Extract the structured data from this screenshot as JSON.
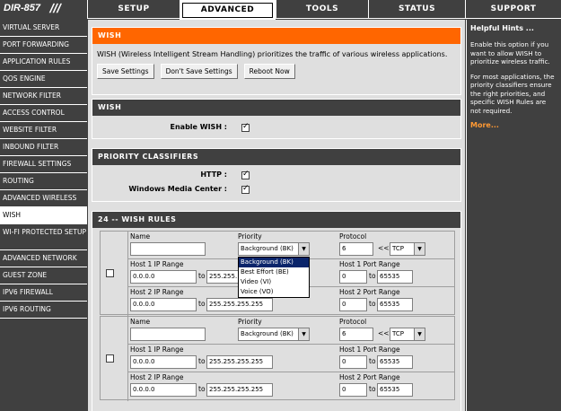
{
  "brand": {
    "logo": "DIR-857",
    "slashes": "///"
  },
  "top_tabs": [
    {
      "label": "SETUP"
    },
    {
      "label": "ADVANCED"
    },
    {
      "label": "TOOLS"
    },
    {
      "label": "STATUS"
    },
    {
      "label": "SUPPORT"
    }
  ],
  "sidebar": {
    "items": [
      {
        "label": "VIRTUAL SERVER"
      },
      {
        "label": "PORT FORWARDING"
      },
      {
        "label": "APPLICATION RULES"
      },
      {
        "label": "QOS ENGINE"
      },
      {
        "label": "NETWORK FILTER"
      },
      {
        "label": "ACCESS CONTROL"
      },
      {
        "label": "WEBSITE FILTER"
      },
      {
        "label": "INBOUND FILTER"
      },
      {
        "label": "FIREWALL SETTINGS"
      },
      {
        "label": "ROUTING"
      },
      {
        "label": "ADVANCED WIRELESS"
      },
      {
        "label": "WISH"
      },
      {
        "label": "WI-FI PROTECTED SETUP"
      },
      {
        "label": "ADVANCED NETWORK"
      },
      {
        "label": "GUEST ZONE"
      },
      {
        "label": "IPV6 FIREWALL"
      },
      {
        "label": "IPV6 ROUTING"
      }
    ],
    "active": "WISH"
  },
  "wish_intro": {
    "title": "WISH",
    "description": "WISH (Wireless Intelligent Stream Handling) prioritizes the traffic of various wireless applications.",
    "save_label": "Save Settings",
    "dont_save_label": "Don't Save Settings",
    "reboot_label": "Reboot Now"
  },
  "wish_section": {
    "title": "WISH",
    "enable_label": "Enable WISH :",
    "enable_checked": true
  },
  "priority_classifiers": {
    "title": "PRIORITY CLASSIFIERS",
    "http_label": "HTTP :",
    "http_checked": true,
    "wmc_label": "Windows Media Center :",
    "wmc_checked": true
  },
  "wish_rules": {
    "title": "24 -- WISH RULES",
    "labels": {
      "name": "Name",
      "priority": "Priority",
      "protocol": "Protocol",
      "host1_ip": "Host 1 IP Range",
      "host1_port": "Host 1 Port Range",
      "host2_ip": "Host 2 IP Range",
      "host2_port": "Host 2 Port Range",
      "to": "to",
      "arrows": "<<"
    },
    "rules": [
      {
        "name": "",
        "priority": "Background (BK)",
        "protocol_num": "6",
        "protocol": "TCP",
        "host1_ip_from": "0.0.0.0",
        "host1_ip_to": "255.255.",
        "host1_port_from": "0",
        "host1_port_to": "65535",
        "host2_ip_from": "0.0.0.0",
        "host2_ip_to": "255.255.255.255",
        "host2_port_from": "0",
        "host2_port_to": "65535"
      },
      {
        "name": "",
        "priority": "Background (BK)",
        "protocol_num": "6",
        "protocol": "TCP",
        "host1_ip_from": "0.0.0.0",
        "host1_ip_to": "255.255.255.255",
        "host1_port_from": "0",
        "host1_port_to": "65535",
        "host2_ip_from": "0.0.0.0",
        "host2_ip_to": "255.255.255.255",
        "host2_port_from": "0",
        "host2_port_to": "65535"
      }
    ],
    "priority_options": [
      "Background (BK)",
      "Best Effort (BE)",
      "Video (VI)",
      "Voice (VO)"
    ]
  },
  "hints": {
    "title": "Helpful Hints ...",
    "p1": "Enable this option if you want to allow WISH to prioritize wireless traffic.",
    "p2": "For most applications, the priority classifiers ensure the right priorities, and specific WISH Rules are not required.",
    "more": "More..."
  },
  "colors": {
    "accent": "#ff6600",
    "dark": "#404040",
    "panel": "#dfdfdf"
  }
}
